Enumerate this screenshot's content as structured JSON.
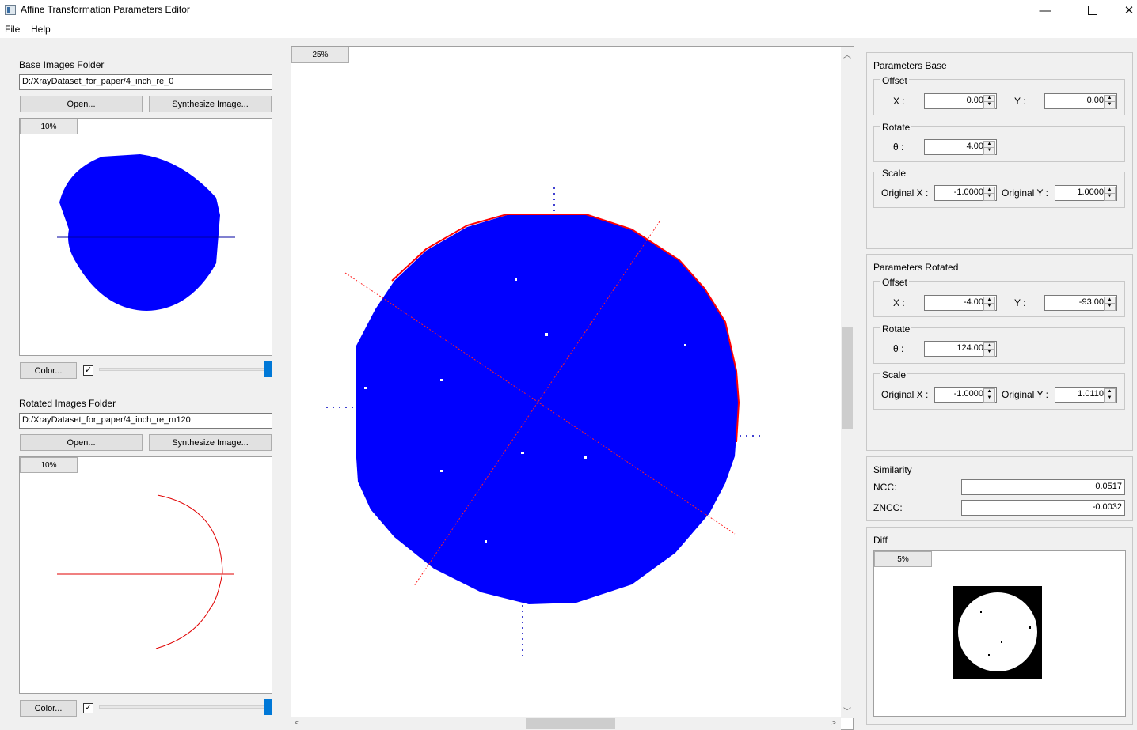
{
  "window": {
    "title": "Affine Transformation Parameters Editor"
  },
  "menu": [
    "File",
    "Help"
  ],
  "base": {
    "section_label": "Base Images Folder",
    "folder_path": "D:/XrayDataset_for_paper/4_inch_re_0",
    "open_label": "Open...",
    "synth_label": "Synthesize Image...",
    "zoom": "10%",
    "color_label": "Color...",
    "checkbox_checked": true,
    "checkbox_glyph": "✓",
    "opacity_fraction": 1.0
  },
  "rotated": {
    "section_label": "Rotated Images Folder",
    "folder_path": "D:/XrayDataset_for_paper/4_inch_re_m120",
    "open_label": "Open...",
    "synth_label": "Synthesize Image...",
    "zoom": "10%",
    "color_label": "Color...",
    "checkbox_checked": true,
    "checkbox_glyph": "✓",
    "opacity_fraction": 1.0
  },
  "center_view": {
    "zoom": "25%"
  },
  "params_base": {
    "title": "Parameters Base",
    "offset_title": "Offset",
    "x_label": "X :",
    "x_value": "0.00",
    "y_label": "Y :",
    "y_value": "0.00",
    "rotate_title": "Rotate",
    "theta_label": "θ :",
    "theta_value": "4.00",
    "scale_title": "Scale",
    "orig_x_label": "Original X :",
    "orig_x_value": "-1.0000",
    "orig_y_label": "Original Y :",
    "orig_y_value": "1.0000"
  },
  "params_rotated": {
    "title": "Parameters Rotated",
    "offset_title": "Offset",
    "x_label": "X :",
    "x_value": "-4.00",
    "y_label": "Y :",
    "y_value": "-93.00",
    "rotate_title": "Rotate",
    "theta_label": "θ :",
    "theta_value": "124.00",
    "scale_title": "Scale",
    "orig_x_label": "Original X :",
    "orig_x_value": "-1.0000",
    "orig_y_label": "Original Y :",
    "orig_y_value": "1.0110"
  },
  "similarity": {
    "title": "Similarity",
    "ncc_label": "NCC:",
    "ncc_value": "0.0517",
    "zncc_label": "ZNCC:",
    "zncc_value": "-0.0032"
  },
  "diff": {
    "title": "Diff",
    "zoom": "5%"
  },
  "colors": {
    "base": "#0000ff",
    "rotated": "#e00000",
    "accent": "#0078d7"
  },
  "icons": {
    "minimize": "minimize-icon",
    "maximize": "maximize-icon",
    "close": "close-icon"
  }
}
